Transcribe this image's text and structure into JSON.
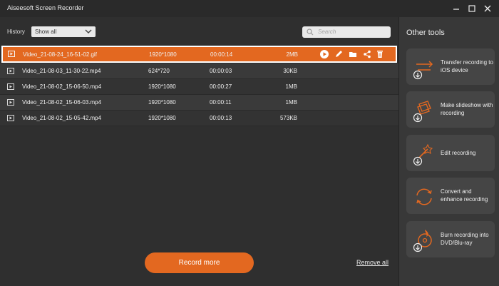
{
  "window": {
    "title": "Aiseesoft Screen Recorder"
  },
  "filter": {
    "label": "History",
    "selected": "Show all"
  },
  "search": {
    "placeholder": "Search"
  },
  "recordings": [
    {
      "name": "Video_21-08-24_16-51-02.gif",
      "resolution": "1920*1080",
      "duration": "00:00:14",
      "size": "2MB",
      "selected": true
    },
    {
      "name": "Video_21-08-03_11-30-22.mp4",
      "resolution": "624*720",
      "duration": "00:00:03",
      "size": "30KB"
    },
    {
      "name": "Video_21-08-02_15-06-50.mp4",
      "resolution": "1920*1080",
      "duration": "00:00:27",
      "size": "1MB"
    },
    {
      "name": "Video_21-08-02_15-06-03.mp4",
      "resolution": "1920*1080",
      "duration": "00:00:11",
      "size": "1MB"
    },
    {
      "name": "Video_21-08-02_15-05-42.mp4",
      "resolution": "1920*1080",
      "duration": "00:00:13",
      "size": "573KB"
    }
  ],
  "row_actions": [
    "play-icon",
    "edit-icon",
    "folder-icon",
    "share-icon",
    "delete-icon"
  ],
  "footer": {
    "record_more": "Record more",
    "remove_all": "Remove all"
  },
  "side": {
    "title": "Other tools",
    "tools": [
      {
        "label": "Transfer recording to iOS device",
        "icon": "transfer-icon"
      },
      {
        "label": "Make slideshow with recording",
        "icon": "slideshow-icon"
      },
      {
        "label": "Edit recording",
        "icon": "edit-magic-icon"
      },
      {
        "label": "Convert and enhance recording",
        "icon": "convert-icon"
      },
      {
        "label": "Burn recording into DVD/Blu-ray",
        "icon": "burn-disc-icon"
      }
    ]
  },
  "colors": {
    "accent": "#e36820",
    "background": "#2f2f2f",
    "sidebar": "#383838"
  }
}
